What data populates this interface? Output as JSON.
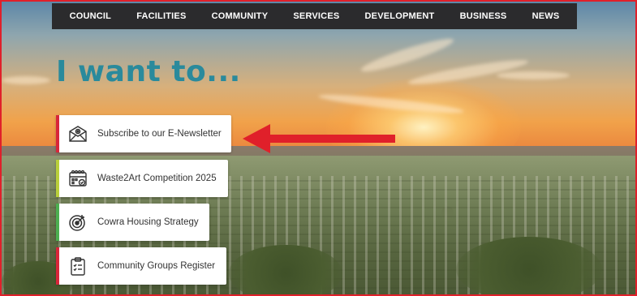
{
  "nav": {
    "items": [
      "COUNCIL",
      "FACILITIES",
      "COMMUNITY",
      "SERVICES",
      "DEVELOPMENT",
      "BUSINESS",
      "NEWS"
    ]
  },
  "hero": {
    "heading": "I want to..."
  },
  "quick_links": [
    {
      "label": "Subscribe to our E-Newsletter",
      "icon": "envelope-icon",
      "accent": "#d8263a"
    },
    {
      "label": "Waste2Art Competition 2025",
      "icon": "calendar-icon",
      "accent": "#b9cf3a"
    },
    {
      "label": "Cowra Housing Strategy",
      "icon": "target-icon",
      "accent": "#4caf50"
    },
    {
      "label": "Community Groups Register",
      "icon": "clipboard-icon",
      "accent": "#d8263a"
    }
  ],
  "colors": {
    "nav_bg": "#2b2b2d",
    "heading": "#2a8a9c",
    "arrow": "#e0202a",
    "border": "#e0202a"
  }
}
